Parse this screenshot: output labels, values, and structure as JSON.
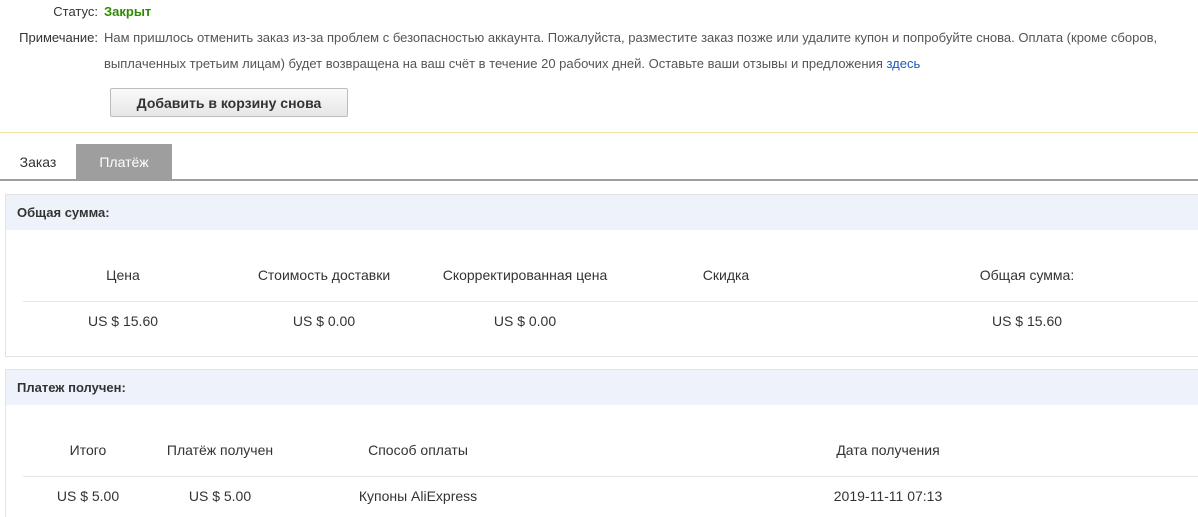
{
  "order_info": {
    "status_label": "Статус:",
    "status_value": "Закрыт",
    "status_color": "#2e8b00",
    "note_label": "Примечание:",
    "note_text": "Нам пришлось отменить заказ из-за проблем с безопасностью аккаунта. Пожалуйста, разместите заказ позже или удалите купон и попробуйте снова. Оплата (кроме сборов, выплаченных третьим лицам) будет возвращена на ваш счёт в течение 20 рабочих дней. Оставьте ваши отзывы и предложения",
    "note_link": "здесь",
    "readd_button": "Добавить в корзину снова"
  },
  "tabs": [
    {
      "label": "Заказ",
      "active": false
    },
    {
      "label": "Платёж",
      "active": true
    }
  ],
  "total_panel": {
    "title": "Общая сумма:",
    "headers": [
      "Цена",
      "Стоимость доставки",
      "Скорректированная цена",
      "Скидка",
      "Общая сумма:"
    ],
    "row": [
      "US $ 15.60",
      "US $ 0.00",
      "US $ 0.00",
      "",
      "US $ 15.60"
    ]
  },
  "payment_panel": {
    "title": "Платеж получен:",
    "headers": [
      "Итого",
      "Платёж получен",
      "Способ оплаты",
      "Дата получения"
    ],
    "row": [
      "US $ 5.00",
      "US $ 5.00",
      "Купоны AliExpress",
      "2019-11-11 07:13"
    ]
  },
  "colors": {
    "accent_link": "#1a5bb8",
    "panel_header_bg": "#eef3fb",
    "tab_active_bg": "#9e9e9e",
    "divider_yellow": "#f0e4a8"
  }
}
